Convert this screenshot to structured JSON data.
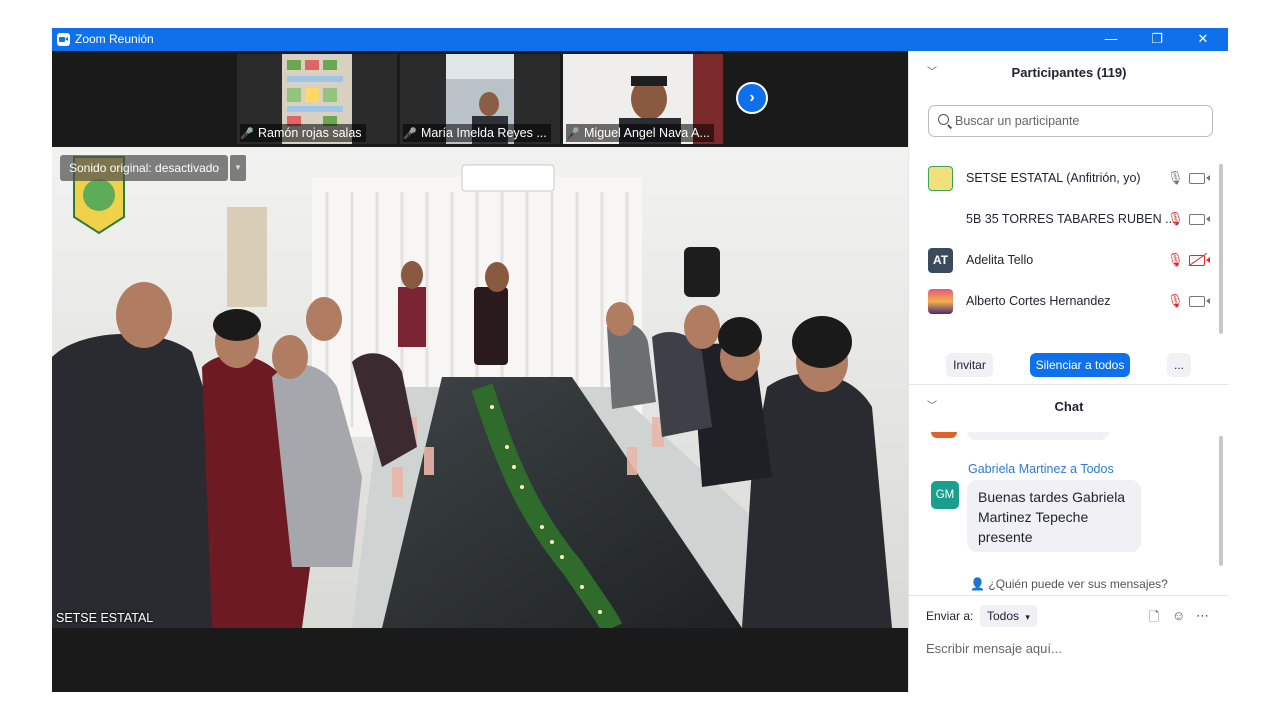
{
  "window": {
    "title": "Zoom Reunión",
    "minimize": "—",
    "restore": "❐",
    "close": "✕"
  },
  "thumbnails": [
    {
      "name": "Ramón rojas salas",
      "muted": true
    },
    {
      "name": "María Imelda Reyes ...",
      "muted": true
    },
    {
      "name": "Miguel Angel Nava A...",
      "muted": true
    }
  ],
  "next_page_icon": "chevron-right-icon",
  "main_video": {
    "sound_button": "Sonido original: desactivado",
    "speaker_name": "SETSE ESTATAL"
  },
  "participants": {
    "header": "Participantes (119)",
    "search_placeholder": "Buscar un participante",
    "list": [
      {
        "name": "SETSE ESTATAL (Anfitrión, yo)",
        "initials": "",
        "mic": "on",
        "camera": "on",
        "avatar_color": "#f4e07a"
      },
      {
        "name": "5B 35 TORRES TABARES RUBEN ...",
        "initials": "",
        "mic": "muted",
        "camera": "on",
        "avatar_color": ""
      },
      {
        "name": "Adelita Tello",
        "initials": "AT",
        "mic": "muted",
        "camera": "off",
        "avatar_color": "#3c4a5e"
      },
      {
        "name": "Alberto Cortes Hernandez",
        "initials": "",
        "mic": "muted",
        "camera": "on",
        "avatar_color": "#4b2a7a"
      }
    ],
    "buttons": {
      "invite": "Invitar",
      "mute_all": "Silenciar a todos",
      "more": "..."
    }
  },
  "chat": {
    "header": "Chat",
    "messages": [
      {
        "sender": "Gabriela Martinez",
        "recipient_prefix": "a",
        "recipient": "Todos",
        "initials": "GM",
        "avatar_color": "#1a9e8e",
        "lines": [
          "Buenas tardes Gabriela",
          "Martinez Tepeche",
          "presente"
        ]
      }
    ],
    "who_can_see": "¿Quién puede ver sus mensajes?",
    "send_to_label": "Enviar a:",
    "send_to_value": "Todos",
    "input_placeholder": "Escribir mensaje aquí..."
  }
}
